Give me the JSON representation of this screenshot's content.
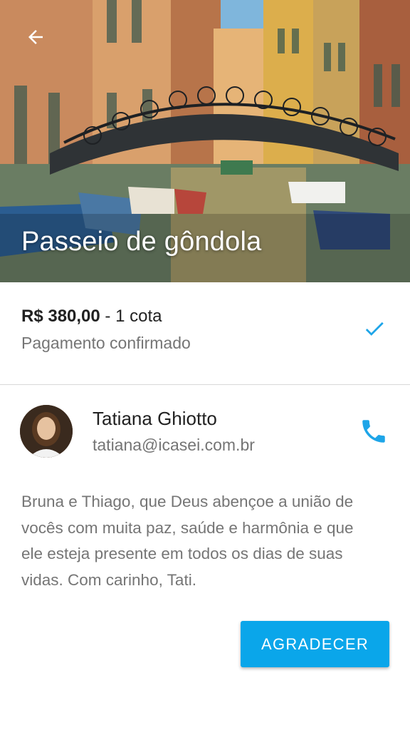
{
  "header": {
    "title": "Passeio de gôndola",
    "back_icon": "arrow-left-icon"
  },
  "payment": {
    "amount": "R$ 380,00",
    "separator": " - ",
    "quota": "1 cota",
    "status": "Pagamento confirmado",
    "status_icon": "check-icon",
    "accent_color": "#1ea5e8"
  },
  "giver": {
    "name": "Tatiana Ghiotto",
    "email": "tatiana@icasei.com.br",
    "contact_icon": "phone-icon"
  },
  "message": {
    "lines": [
      "Bruna e Thiago, que Deus abençoe a união de",
      "vocês com muita paz, saúde e harmônia e que",
      "ele esteja presente em todos os dias de suas",
      "vidas. Com carinho, Tati."
    ]
  },
  "actions": {
    "thank_label": "AGRADECER",
    "button_color": "#0aa6ea"
  }
}
